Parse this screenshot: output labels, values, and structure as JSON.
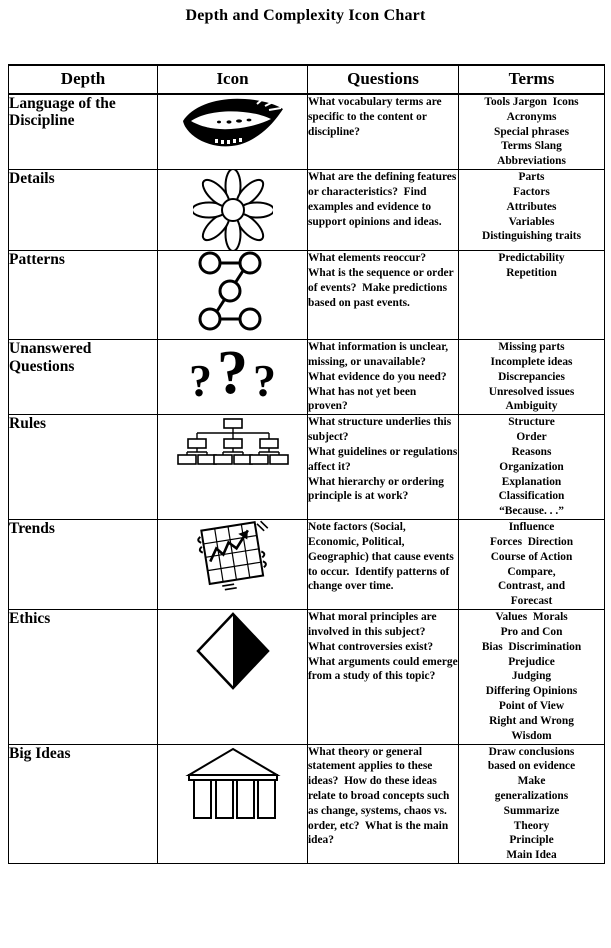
{
  "title": "Depth and Complexity Icon Chart",
  "table": {
    "headers": [
      "Depth",
      "Icon",
      "Questions",
      "Terms"
    ],
    "rows": [
      {
        "depth": "Language of\nthe Discipline",
        "icon": "lips-icon",
        "questions": "What vocabulary terms are specific to the content or discipline?",
        "terms": "Tools Jargon  Icons\nAcronyms\nSpecial phrases\nTerms Slang\nAbbreviations"
      },
      {
        "depth": "Details",
        "icon": "flower-icon",
        "questions": "What are the defining features or characteristics?  Find examples and evidence to support opinions and ideas.",
        "terms": "Parts\nFactors\nAttributes\nVariables\nDistinguishing traits"
      },
      {
        "depth": "Patterns",
        "icon": "connected-circles-icon",
        "questions": "What elements reoccur?  What is the sequence or order of events?  Make predictions based on past events.",
        "terms": "Predictability\nRepetition"
      },
      {
        "depth": "Unanswered\nQuestions",
        "icon": "question-marks-icon",
        "questions": "What information is unclear, missing, or unavailable?  What evidence do you need?  What has not yet been proven?",
        "terms": "Missing parts\nIncomplete ideas\nDiscrepancies\nUnresolved issues\nAmbiguity"
      },
      {
        "depth": "Rules",
        "icon": "org-chart-icon",
        "questions": "What structure underlies this subject?\nWhat guidelines or regulations affect it?\nWhat hierarchy or ordering principle is at work?",
        "terms": "Structure\nOrder\nReasons\nOrganization\nExplanation\nClassification\n“Because. . .”"
      },
      {
        "depth": "Trends",
        "icon": "graph-arrow-icon",
        "questions": "Note factors (Social, Economic, Political, Geographic) that cause events to occur.  Identify patterns of change over time.",
        "terms": "Influence\nForces  Direction\nCourse of Action\nCompare,\nContrast, and\nForecast"
      },
      {
        "depth": "Ethics",
        "icon": "half-shaded-diamond-icon",
        "questions": "What moral principles are involved in this subject?  What controversies exist?  What arguments could emerge from a study of this topic?",
        "terms": "Values  Morals\nPro and Con\nBias  Discrimination\nPrejudice\nJudging\nDiffering Opinions\nPoint of View\nRight and Wrong\nWisdom"
      },
      {
        "depth": "Big Ideas",
        "icon": "temple-icon",
        "questions": "What theory or general statement applies to these ideas?  How do these ideas relate to broad concepts such as change, systems, chaos vs. order, etc?  What is the main idea?",
        "terms": "Draw conclusions\nbased on evidence\nMake\ngeneralizations\nSummarize\nTheory\nPrinciple\nMain Idea"
      }
    ]
  },
  "question_marks": {
    "left": "?",
    "center": "?",
    "right": "?"
  }
}
